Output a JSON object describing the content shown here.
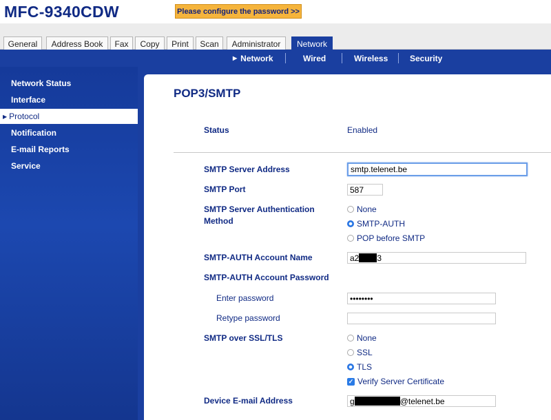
{
  "header": {
    "model": "MFC-9340CDW",
    "password_warning": "Please configure the password >>"
  },
  "tabs": [
    {
      "label": "General"
    },
    {
      "label": "Address Book"
    },
    {
      "label": "Fax"
    },
    {
      "label": "Copy"
    },
    {
      "label": "Print"
    },
    {
      "label": "Scan"
    },
    {
      "label": "Administrator"
    },
    {
      "label": "Network",
      "active": true
    }
  ],
  "subnav": [
    {
      "label": "Network",
      "active": true
    },
    {
      "label": "Wired"
    },
    {
      "label": "Wireless"
    },
    {
      "label": "Security"
    }
  ],
  "sidebar": {
    "items": [
      {
        "label": "Network Status"
      },
      {
        "label": "Interface"
      },
      {
        "label": "Protocol",
        "active": true
      },
      {
        "label": "Notification"
      },
      {
        "label": "E-mail Reports"
      },
      {
        "label": "Service"
      }
    ]
  },
  "main": {
    "title": "POP3/SMTP",
    "status_label": "Status",
    "status_value": "Enabled",
    "smtp_server_label": "SMTP Server Address",
    "smtp_server_value": "smtp.telenet.be",
    "smtp_port_label": "SMTP Port",
    "smtp_port_value": "587",
    "auth_method_label_line1": "SMTP Server Authentication",
    "auth_method_label_line2": "Method",
    "auth_options": [
      {
        "label": "None",
        "selected": false
      },
      {
        "label": "SMTP-AUTH",
        "selected": true
      },
      {
        "label": "POP before SMTP",
        "selected": false
      }
    ],
    "account_name_label": "SMTP-AUTH Account Name",
    "account_name_prefix": "a2",
    "account_name_suffix": "3",
    "account_password_label": "SMTP-AUTH Account Password",
    "enter_password_label": "Enter password",
    "enter_password_value": "••••••••",
    "retype_password_label": "Retype password",
    "retype_password_value": "",
    "ssl_label": "SMTP over SSL/TLS",
    "ssl_options": [
      {
        "label": "None",
        "selected": false
      },
      {
        "label": "SSL",
        "selected": false
      },
      {
        "label": "TLS",
        "selected": true
      }
    ],
    "verify_cert_label": "Verify Server Certificate",
    "verify_cert_checked": true,
    "device_email_label": "Device E-mail Address",
    "device_email_prefix": "g",
    "device_email_suffix": "@telenet.be"
  }
}
